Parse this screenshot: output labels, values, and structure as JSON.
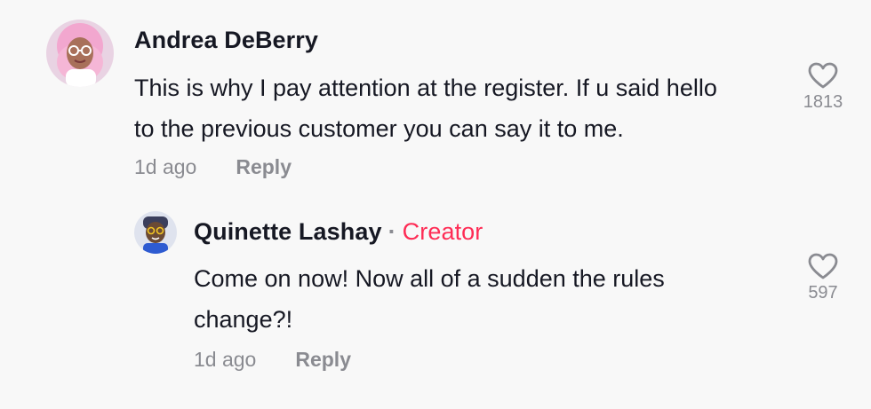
{
  "comments": [
    {
      "username": "Andrea DeBerry",
      "text_line1": "This is why I pay attention at the register. If u said hello",
      "text_line2": "to the previous customer you can say it to me.",
      "time": "1d ago",
      "reply_label": "Reply",
      "likes": "1813",
      "icon": "heart-icon"
    }
  ],
  "reply": {
    "username": "Quinette Lashay",
    "separator": "·",
    "badge": "Creator",
    "text_line1": "Come on now! Now all of a sudden the rules",
    "text_line2": "change?!",
    "time": "1d ago",
    "reply_label": "Reply",
    "likes": "597",
    "icon": "heart-icon"
  },
  "colors": {
    "background": "#f8f8f8",
    "creator_badge": "#fe2c55",
    "muted": "#8a8b91"
  }
}
